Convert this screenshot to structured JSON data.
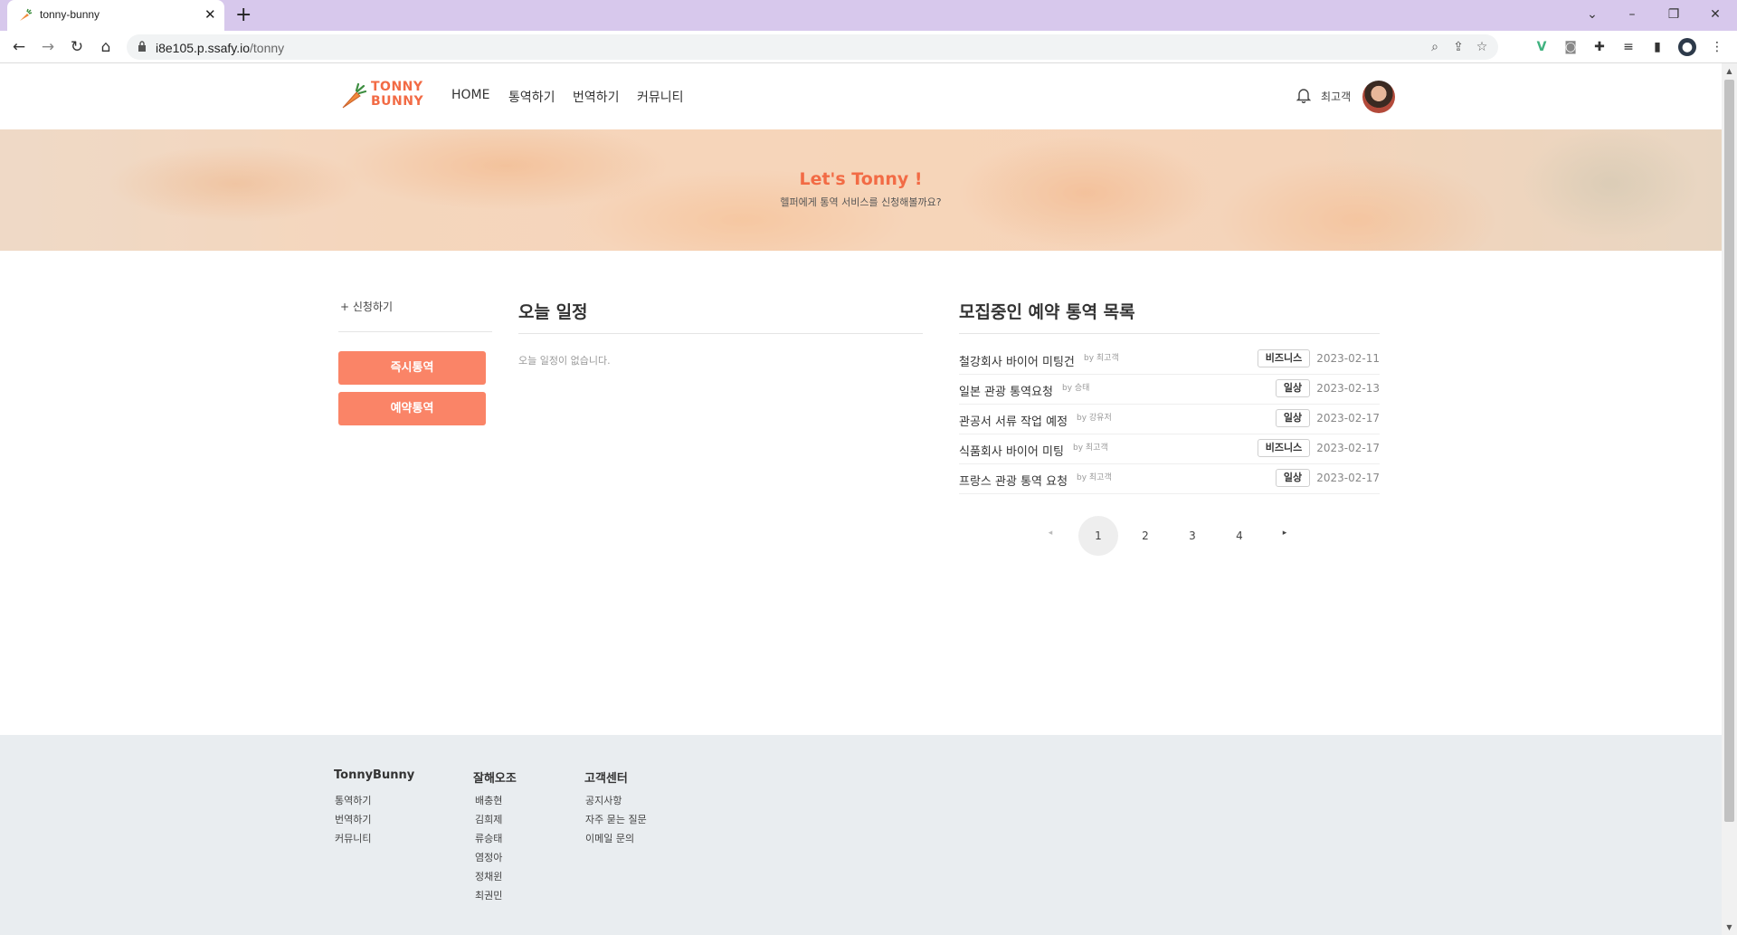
{
  "browser": {
    "tab_title": "tonny-bunny",
    "url_host": "i8e105.p.ssafy.io",
    "url_path": "/tonny"
  },
  "header": {
    "logo_line1": "TONNY",
    "logo_line2": "BUNNY",
    "nav": [
      "HOME",
      "통역하기",
      "번역하기",
      "커뮤니티"
    ],
    "username": "최고객"
  },
  "hero": {
    "title": "Let's Tonny !",
    "subtitle": "헬퍼에게 통역 서비스를 신청해볼까요?"
  },
  "sidebar": {
    "apply_label": "신청하기",
    "buttons": [
      "즉시통역",
      "예약통역"
    ]
  },
  "today": {
    "title": "오늘 일정",
    "empty": "오늘 일정이 없습니다."
  },
  "reservations": {
    "title": "모집중인 예약 통역 목록",
    "items": [
      {
        "title": "철강회사 바이어 미팅건",
        "author": "by 최고객",
        "tag": "비즈니스",
        "date": "2023-02-11"
      },
      {
        "title": "일본 관광 통역요청",
        "author": "by 승태",
        "tag": "일상",
        "date": "2023-02-13"
      },
      {
        "title": "관공서 서류 작업 예정",
        "author": "by 강유저",
        "tag": "일상",
        "date": "2023-02-17"
      },
      {
        "title": "식품회사 바이어 미팅",
        "author": "by 최고객",
        "tag": "비즈니스",
        "date": "2023-02-17"
      },
      {
        "title": "프랑스 관광 통역 요청",
        "author": "by 최고객",
        "tag": "일상",
        "date": "2023-02-17"
      }
    ]
  },
  "pagination": {
    "pages": [
      "1",
      "2",
      "3",
      "4"
    ],
    "current": "1"
  },
  "footer": {
    "columns": [
      {
        "heading": "TonnyBunny",
        "links": [
          "통역하기",
          "번역하기",
          "커뮤니티"
        ]
      },
      {
        "heading": "잘해오조",
        "links": [
          "배충현",
          "김희제",
          "류승태",
          "염정아",
          "정채윈",
          "최권민"
        ]
      },
      {
        "heading": "고객센터",
        "links": [
          "공지사항",
          "자주 묻는 질문",
          "이메일 문의"
        ]
      }
    ]
  },
  "colors": {
    "brand": "#f26b45",
    "button": "#fa8467",
    "footer_bg": "#e9edf0",
    "tabbar_bg": "#d7c8ec"
  }
}
